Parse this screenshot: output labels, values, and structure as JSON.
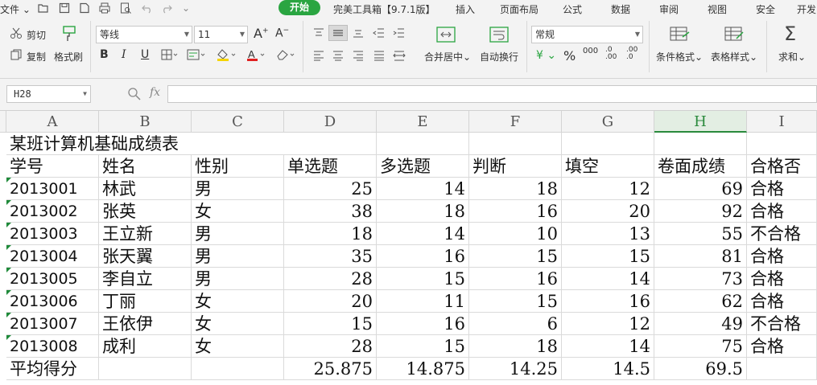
{
  "menubar": {
    "file_label": "文件",
    "tabs": [
      "开始",
      "完美工具箱【9.7.1版】",
      "插入",
      "页面布局",
      "公式",
      "数据",
      "审阅",
      "视图",
      "安全",
      "开发"
    ]
  },
  "ribbon": {
    "cut": "剪切",
    "copy": "复制",
    "format_painter": "格式刷",
    "font_name": "等线",
    "font_size": "11",
    "merge_center": "合并居中",
    "wrap_text": "自动换行",
    "number_format": "常规",
    "percent": "%",
    "thousands": "000",
    "inc_decimal": ".0 .00",
    "dec_decimal": ".00 .0",
    "conditional_format": "条件格式",
    "table_style": "表格样式",
    "sum": "求和",
    "colors": {
      "accent": "#2aa541",
      "font_color": "#e02020",
      "fill_color": "#f5d400"
    }
  },
  "formula_bar": {
    "name_box": "H28",
    "fx": "fx",
    "value": ""
  },
  "columns": [
    "A",
    "B",
    "C",
    "D",
    "E",
    "F",
    "G",
    "H",
    "I"
  ],
  "selected_column": "H",
  "sheet": {
    "title": "某班计算机基础成绩表",
    "headers": [
      "学号",
      "姓名",
      "性别",
      "单选题",
      "多选题",
      "判断",
      "填空",
      "卷面成绩",
      "合格否"
    ],
    "rows": [
      [
        "2013001",
        "林武",
        "男",
        "25",
        "14",
        "18",
        "12",
        "69",
        "合格"
      ],
      [
        "2013002",
        "张英",
        "女",
        "38",
        "18",
        "16",
        "20",
        "92",
        "合格"
      ],
      [
        "2013003",
        "王立新",
        "男",
        "18",
        "14",
        "10",
        "13",
        "55",
        "不合格"
      ],
      [
        "2013004",
        "张天翼",
        "男",
        "35",
        "16",
        "15",
        "15",
        "81",
        "合格"
      ],
      [
        "2013005",
        "李自立",
        "男",
        "28",
        "15",
        "16",
        "14",
        "73",
        "合格"
      ],
      [
        "2013006",
        "丁丽",
        "女",
        "20",
        "11",
        "15",
        "16",
        "62",
        "合格"
      ],
      [
        "2013007",
        "王依伊",
        "女",
        "15",
        "16",
        "6",
        "12",
        "49",
        "不合格"
      ],
      [
        "2013008",
        "成利",
        "女",
        "28",
        "15",
        "18",
        "14",
        "75",
        "合格"
      ]
    ],
    "average": [
      "平均得分",
      "",
      "",
      "25.875",
      "14.875",
      "14.25",
      "14.5",
      "69.5",
      ""
    ]
  }
}
